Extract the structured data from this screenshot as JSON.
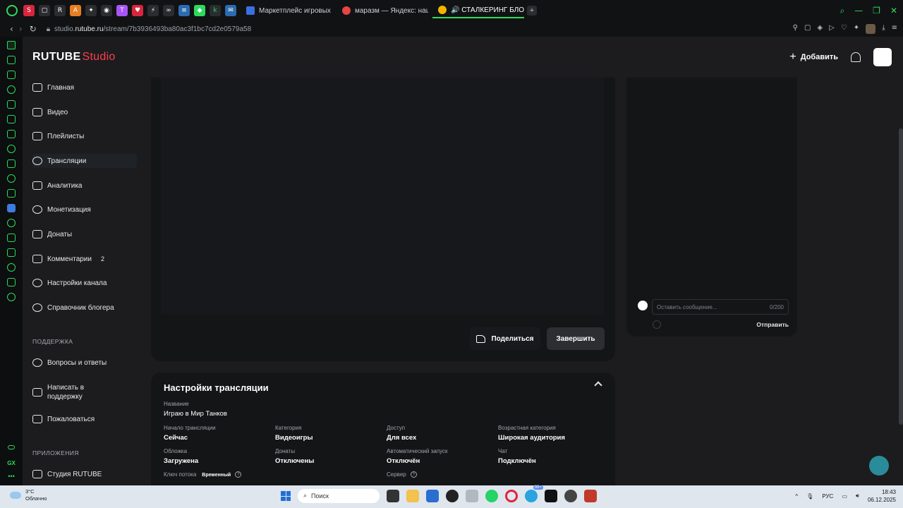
{
  "browser": {
    "tabs": [
      {
        "label": "Маркетплейс игровых то",
        "color": "#3a6fe0"
      },
      {
        "label": "маразм — Яндекс: нашл",
        "color": "#e64545"
      },
      {
        "label": "🔊 СТАЛКЕРИНГ БЛОГЕ",
        "color": "#f2b400",
        "active": true
      }
    ],
    "new_tab": "+",
    "url_prefix": "studio.",
    "url_domain": "rutube.ru",
    "url_path": "/stream/7b3936493ba80ac3f1bc7cd2e0579a58"
  },
  "header": {
    "logo_main": "RUTUBE",
    "logo_sub": "Studio",
    "add_button": "Добавить"
  },
  "sidebar": {
    "items": [
      {
        "label": "Главная",
        "icon": "home-icon"
      },
      {
        "label": "Видео",
        "icon": "video-icon"
      },
      {
        "label": "Плейлисты",
        "icon": "playlist-icon"
      },
      {
        "label": "Трансляции",
        "icon": "broadcast-icon",
        "active": true
      },
      {
        "label": "Аналитика",
        "icon": "analytics-icon"
      },
      {
        "label": "Монетизация",
        "icon": "money-icon"
      },
      {
        "label": "Донаты",
        "icon": "wallet-icon"
      },
      {
        "label": "Комментарии",
        "icon": "comment-icon",
        "badge": "2"
      },
      {
        "label": "Настройки канала",
        "icon": "gear-icon"
      },
      {
        "label": "Справочник блогера",
        "icon": "info-icon"
      }
    ],
    "support_title": "ПОДДЕРЖКА",
    "support_items": [
      {
        "label": "Вопросы и ответы",
        "icon": "help-icon"
      },
      {
        "label": "Написать в поддержку",
        "icon": "mail-icon"
      },
      {
        "label": "Пожаловаться",
        "icon": "flag-icon"
      }
    ],
    "apps_title": "ПРИЛОЖЕНИЯ",
    "apps_items": [
      {
        "label": "Студия RUTUBE",
        "icon": "app-icon"
      }
    ]
  },
  "player": {
    "share_label": "Поделиться",
    "end_label": "Завершить"
  },
  "chat": {
    "placeholder": "Оставить сообщение...",
    "counter": "0/200",
    "send_label": "Отправить"
  },
  "settings": {
    "title": "Настройки трансляции",
    "name_label": "Название",
    "name_value": "Играю в Мир Танков",
    "fields": [
      {
        "label": "Начало трансляции",
        "value": "Сейчас"
      },
      {
        "label": "Категория",
        "value": "Видеоигры"
      },
      {
        "label": "Доступ",
        "value": "Для всех"
      },
      {
        "label": "Возрастная категория",
        "value": "Широкая аудитория"
      },
      {
        "label": "Обложка",
        "value": "Загружена"
      },
      {
        "label": "Донаты",
        "value": "Отключены"
      },
      {
        "label": "Автоматический запуск",
        "value": "Отключён"
      },
      {
        "label": "Чат",
        "value": "Подключён"
      }
    ],
    "stream_key_label": "Ключ потока",
    "stream_key_badge": "Временный",
    "server_label": "Сервер"
  },
  "taskbar": {
    "temperature": "3°C",
    "weather": "Облачно",
    "search_placeholder": "Поиск",
    "language": "РУС",
    "time": "18:43",
    "date": "06.12.2025",
    "notification_badge": "99+"
  }
}
